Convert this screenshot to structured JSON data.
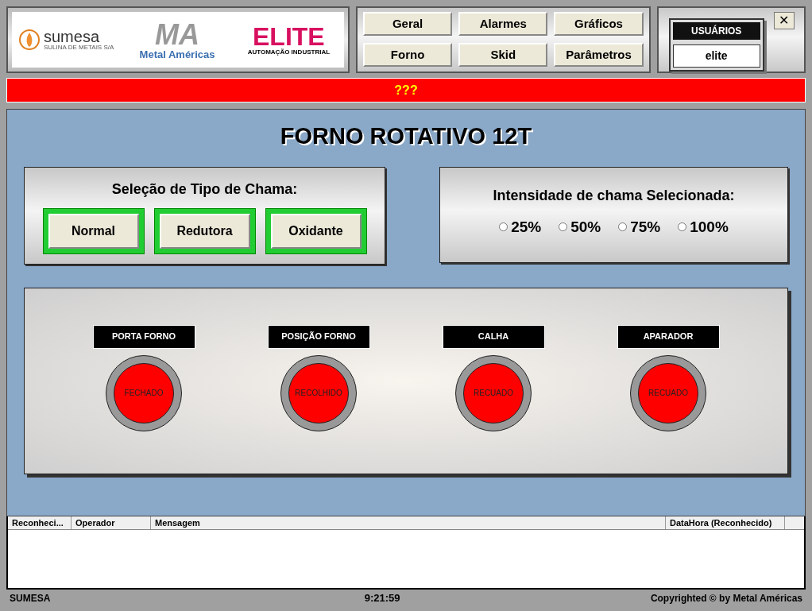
{
  "logos": {
    "sumesa": {
      "name": "sumesa",
      "tagline": "SULINA DE METAIS S/A"
    },
    "metal_americas": {
      "monogram": "MA",
      "name": "Metal Américas"
    },
    "elite": {
      "name": "ELITE",
      "tagline": "AUTOMAÇÃO INDUSTRIAL"
    }
  },
  "nav_buttons": [
    "Geral",
    "Alarmes",
    "Gráficos",
    "Forno",
    "Skid",
    "Parâmetros"
  ],
  "user_panel": {
    "title": "USUÁRIOS",
    "user": "elite",
    "close": "✕"
  },
  "alarm_banner": "???",
  "title": "FORNO ROTATIVO 12T",
  "flame_type": {
    "title": "Seleção de Tipo de Chama:",
    "options": [
      "Normal",
      "Redutora",
      "Oxidante"
    ]
  },
  "flame_intensity": {
    "title": "Intensidade de chama Selecionada:",
    "options": [
      {
        "label": "25%",
        "selected": false
      },
      {
        "label": "50%",
        "selected": false
      },
      {
        "label": "75%",
        "selected": false
      },
      {
        "label": "100%",
        "selected": false
      }
    ]
  },
  "indicators": [
    {
      "label": "PORTA FORNO",
      "status": "FECHADO",
      "color": "#ff0000"
    },
    {
      "label": "POSIÇÃO FORNO",
      "status": "RECOLHIDO",
      "color": "#ff0000"
    },
    {
      "label": "CALHA",
      "status": "RECUADO",
      "color": "#ff0000"
    },
    {
      "label": "APARADOR",
      "status": "RECUADO",
      "color": "#ff0000"
    }
  ],
  "alarm_table": {
    "columns": [
      "Reconheci...",
      "Operador",
      "Mensagem",
      "DataHora (Reconhecido)"
    ]
  },
  "status_bar": {
    "left": "SUMESA",
    "time": "9:21:59",
    "right": "Copyrighted © by Metal Américas"
  }
}
